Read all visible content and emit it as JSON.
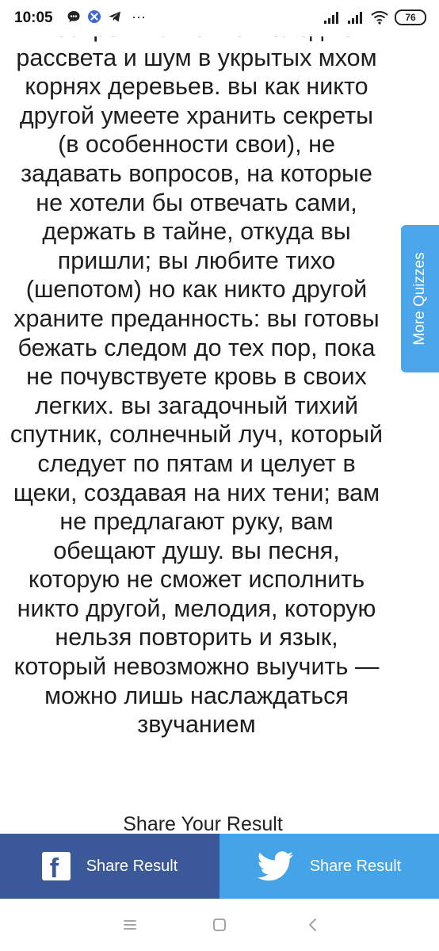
{
  "status_bar": {
    "time": "10:05",
    "icons": [
      "chat-bubble-icon",
      "app-x-icon",
      "telegram-icon",
      "more-dots-icon",
      "signal-icon",
      "signal-icon",
      "wifi-icon",
      "battery-icon"
    ],
    "overflow": "···",
    "battery_level": "76"
  },
  "article": {
    "text": "Беспрепятственно молодые рассвета и шум в укрытых мхом корнях деревьев. вы как никто другой умеете хранить секреты (в особенности свои), не задавать вопросов, на которые не хотели бы отвечать сами, держать в тайне, откуда вы пришли; вы любите тихо (шепотом) но как никто другой храните преданность: вы готовы бежать следом до тех пор, пока не почувствуете кровь в своих легких. вы загадочный тихий спутник, солнечный луч, который следует по пятам и целует в щеки, создавая на них тени; вам не предлагают руку, вам обещают душу. вы песня, которую не сможет исполнить никто другой, мелодия, которую нельзя повторить и язык, который невозможно выучить — можно лишь наслаждаться звучанием"
  },
  "side_tab": {
    "label": "More Quizzes",
    "color": "#4ca6ec"
  },
  "share": {
    "heading": "Share Your Result",
    "facebook": {
      "label": "Share Result",
      "color": "#3b5998",
      "icon": "facebook-icon",
      "glyph": "f"
    },
    "twitter": {
      "label": "Share Result",
      "color": "#45a3e8",
      "icon": "twitter-icon"
    }
  },
  "nav_bar": {
    "buttons": [
      "menu-icon",
      "home-icon",
      "back-icon"
    ]
  }
}
